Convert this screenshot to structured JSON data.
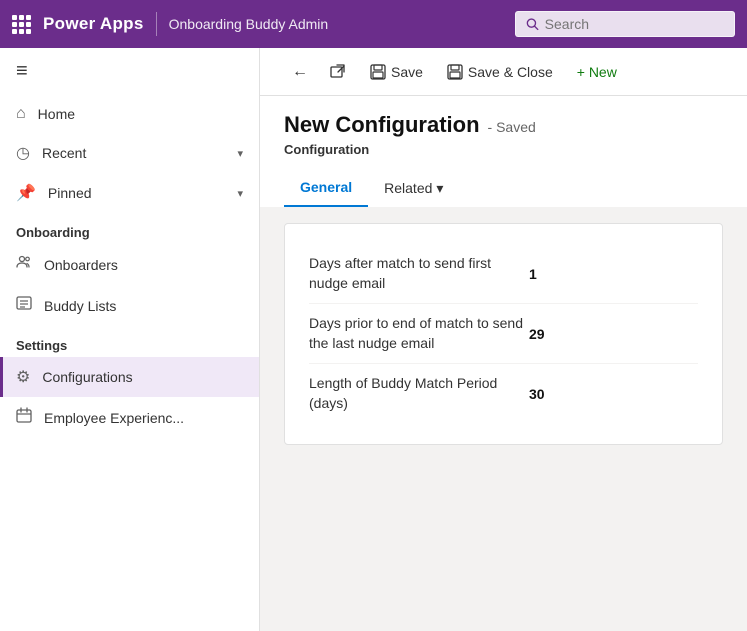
{
  "topbar": {
    "app_title": "Power Apps",
    "section_title": "Onboarding Buddy Admin",
    "search_placeholder": "Search"
  },
  "toolbar": {
    "back_label": "←",
    "open_label": "⤢",
    "save_label": "Save",
    "save_close_label": "Save & Close",
    "new_label": "+ New"
  },
  "sidebar": {
    "menu_icon": "≡",
    "items": [
      {
        "id": "home",
        "icon": "⌂",
        "label": "Home",
        "has_chevron": false
      },
      {
        "id": "recent",
        "icon": "◷",
        "label": "Recent",
        "has_chevron": true
      },
      {
        "id": "pinned",
        "icon": "📌",
        "label": "Pinned",
        "has_chevron": true
      }
    ],
    "sections": [
      {
        "header": "Onboarding",
        "items": [
          {
            "id": "onboarders",
            "icon": "👤",
            "label": "Onboarders"
          },
          {
            "id": "buddy-lists",
            "icon": "📋",
            "label": "Buddy Lists"
          }
        ]
      },
      {
        "header": "Settings",
        "items": [
          {
            "id": "configurations",
            "icon": "⚙",
            "label": "Configurations",
            "active": true
          },
          {
            "id": "employee-experience",
            "icon": "📅",
            "label": "Employee Experienc..."
          }
        ]
      }
    ]
  },
  "page": {
    "title": "New Configuration",
    "status": "- Saved",
    "subtitle": "Configuration",
    "tabs": [
      {
        "id": "general",
        "label": "General",
        "active": true
      },
      {
        "id": "related",
        "label": "Related",
        "has_dropdown": true
      }
    ]
  },
  "form": {
    "fields": [
      {
        "label": "Days after match to send first nudge email",
        "value": "1"
      },
      {
        "label": "Days prior to end of match to send the last nudge email",
        "value": "29"
      },
      {
        "label": "Length of Buddy Match Period (days)",
        "value": "30"
      }
    ]
  }
}
